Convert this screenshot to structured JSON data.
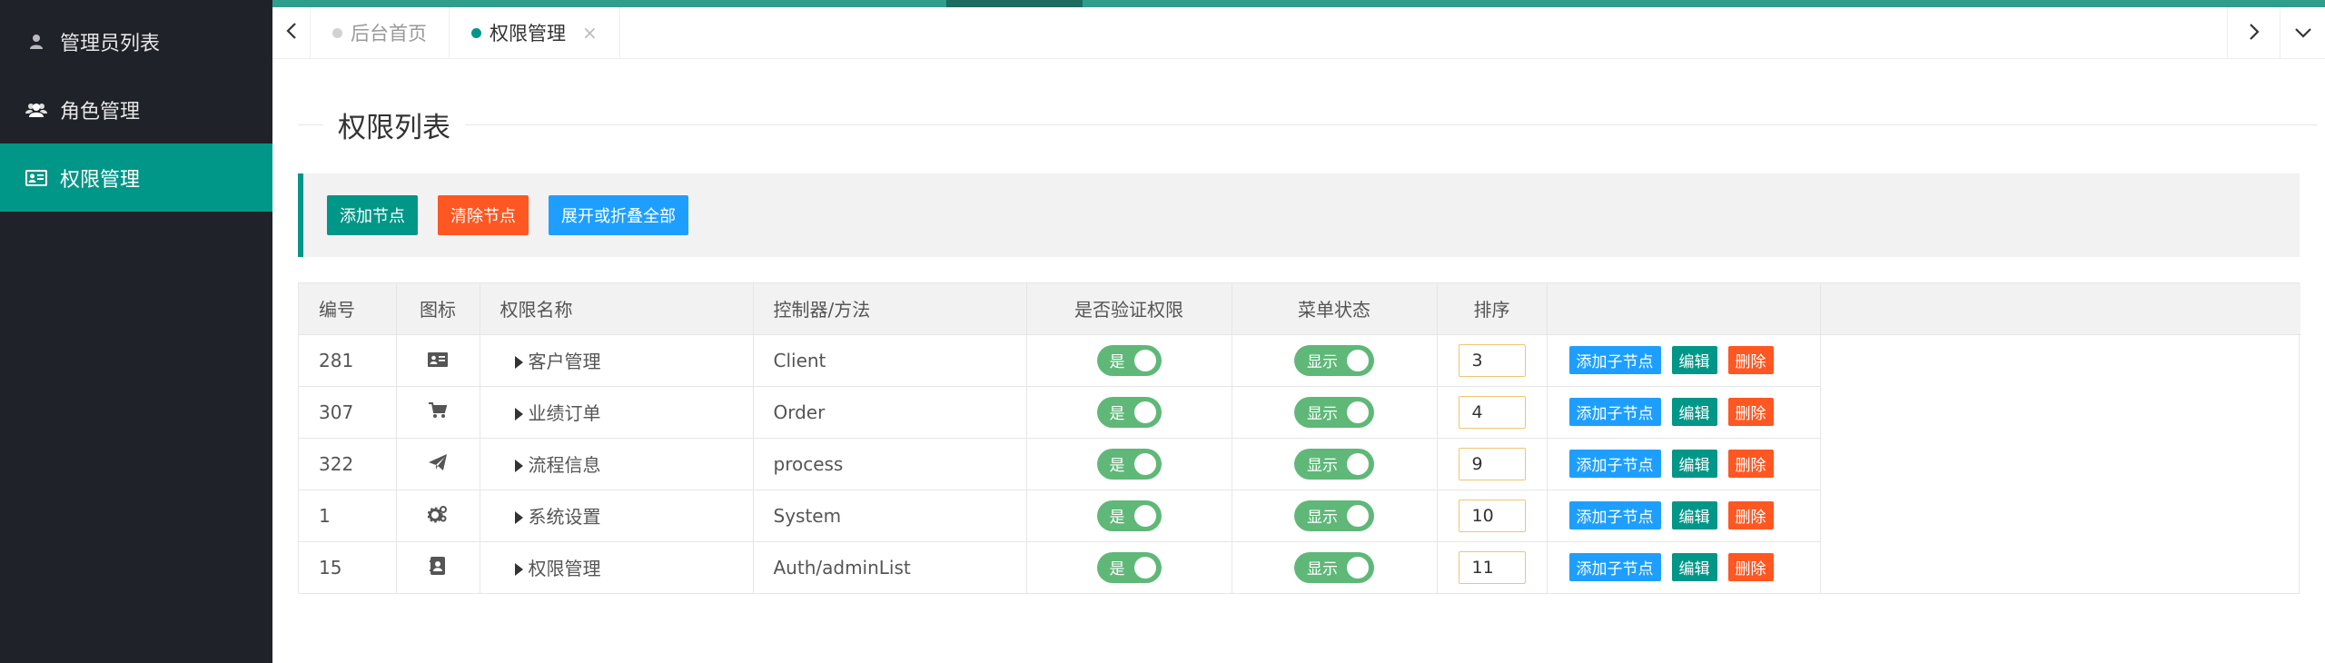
{
  "sidebar": {
    "items": [
      {
        "label": "管理员列表",
        "icon": "user-icon",
        "active": false
      },
      {
        "label": "角色管理",
        "icon": "users-icon",
        "active": false
      },
      {
        "label": "权限管理",
        "icon": "id-card-icon",
        "active": true
      }
    ]
  },
  "tabs": [
    {
      "label": "后台首页",
      "active": false
    },
    {
      "label": "权限管理",
      "active": true,
      "close": "×"
    }
  ],
  "page_title": "权限列表",
  "toolbar": {
    "add_node": "添加节点",
    "clear_node": "清除节点",
    "expand_collapse": "展开或折叠全部"
  },
  "table": {
    "headers": [
      "编号",
      "图标",
      "权限名称",
      "控制器/方法",
      "是否验证权限",
      "菜单状态",
      "排序"
    ],
    "rows": [
      {
        "id": "281",
        "icon": "id-card-icon",
        "name": "客户管理",
        "controller": "Client",
        "auth": "是",
        "menu": "显示",
        "sort": "3"
      },
      {
        "id": "307",
        "icon": "cart-icon",
        "name": "业绩订单",
        "controller": "Order",
        "auth": "是",
        "menu": "显示",
        "sort": "4"
      },
      {
        "id": "322",
        "icon": "paper-plane-icon",
        "name": "流程信息",
        "controller": "process",
        "auth": "是",
        "menu": "显示",
        "sort": "9"
      },
      {
        "id": "1",
        "icon": "gears-icon",
        "name": "系统设置",
        "controller": "System",
        "auth": "是",
        "menu": "显示",
        "sort": "10"
      },
      {
        "id": "15",
        "icon": "contact-book-icon",
        "name": "权限管理",
        "controller": "Auth/adminList",
        "auth": "是",
        "menu": "显示",
        "sort": "11"
      }
    ],
    "actions": {
      "add_child": "添加子节点",
      "edit": "编辑",
      "delete": "删除"
    }
  },
  "colors": {
    "accent": "#009688",
    "sidebar": "#20222a",
    "orange": "#ff5722",
    "blue": "#1e9fff",
    "switch": "#5fb878"
  }
}
